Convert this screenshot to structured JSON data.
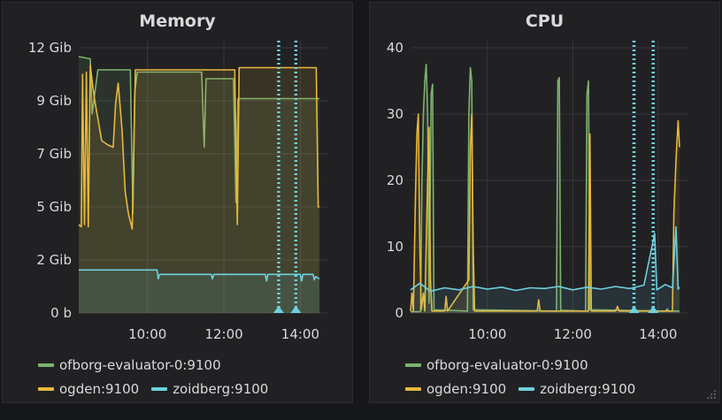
{
  "chart_data": [
    {
      "type": "area",
      "title": "Memory",
      "y_ticks": [
        "0 b",
        "2 Gib",
        "5 Gib",
        "7 Gib",
        "9 Gib",
        "12 Gib"
      ],
      "x_ticks": [
        "10:00",
        "12:00",
        "14:00"
      ],
      "xlim": [
        "08:12",
        "14:30"
      ],
      "ylim": [
        0,
        12
      ],
      "y_unit": "Gib",
      "grid": true,
      "legend_position": "bottom",
      "annotations_at": [
        "13:25",
        "13:52"
      ],
      "series": [
        {
          "name": "ofborg-evaluator-0:9100",
          "color": "#7eb26d",
          "points": [
            [
              "08:12",
              11.6
            ],
            [
              "08:30",
              11.5
            ],
            [
              "08:33",
              9.0
            ],
            [
              "08:42",
              11.0
            ],
            [
              "09:33",
              11.0
            ],
            [
              "09:37",
              4.5
            ],
            [
              "09:40",
              10.0
            ],
            [
              "09:44",
              10.9
            ],
            [
              "11:25",
              10.9
            ],
            [
              "11:29",
              7.5
            ],
            [
              "11:32",
              10.6
            ],
            [
              "12:15",
              10.6
            ],
            [
              "12:19",
              5.0
            ],
            [
              "12:22",
              9.7
            ],
            [
              "14:30",
              9.7
            ]
          ]
        },
        {
          "name": "ogden:9100",
          "color": "#eab839",
          "points": [
            [
              "08:12",
              4.0
            ],
            [
              "08:16",
              3.9
            ],
            [
              "08:18",
              10.8
            ],
            [
              "08:21",
              4.0
            ],
            [
              "08:24",
              10.9
            ],
            [
              "08:27",
              3.9
            ],
            [
              "08:30",
              11.2
            ],
            [
              "08:36",
              9.8
            ],
            [
              "08:48",
              7.8
            ],
            [
              "08:58",
              7.6
            ],
            [
              "09:06",
              7.5
            ],
            [
              "09:10",
              9.5
            ],
            [
              "09:14",
              10.4
            ],
            [
              "09:20",
              8.3
            ],
            [
              "09:25",
              5.5
            ],
            [
              "09:30",
              4.5
            ],
            [
              "09:36",
              3.8
            ],
            [
              "09:41",
              11.0
            ],
            [
              "12:17",
              11.0
            ],
            [
              "12:21",
              4.0
            ],
            [
              "12:24",
              11.1
            ],
            [
              "14:25",
              11.1
            ],
            [
              "14:28",
              4.8
            ],
            [
              "14:30",
              4.8
            ]
          ]
        },
        {
          "name": "zoidberg:9100",
          "color": "#6ed0e0",
          "points": [
            [
              "08:12",
              1.95
            ],
            [
              "10:15",
              1.95
            ],
            [
              "10:17",
              1.55
            ],
            [
              "10:19",
              1.75
            ],
            [
              "11:40",
              1.75
            ],
            [
              "11:42",
              1.55
            ],
            [
              "11:44",
              1.75
            ],
            [
              "13:05",
              1.75
            ],
            [
              "13:07",
              1.45
            ],
            [
              "13:09",
              1.75
            ],
            [
              "14:00",
              1.75
            ],
            [
              "14:02",
              1.45
            ],
            [
              "14:04",
              1.75
            ],
            [
              "14:20",
              1.75
            ],
            [
              "14:22",
              1.5
            ],
            [
              "14:24",
              1.65
            ],
            [
              "14:30",
              1.55
            ]
          ]
        }
      ]
    },
    {
      "type": "line",
      "title": "CPU",
      "y_ticks": [
        "0",
        "10",
        "20",
        "30",
        "40"
      ],
      "x_ticks": [
        "10:00",
        "12:00",
        "14:00"
      ],
      "xlim": [
        "08:12",
        "14:30"
      ],
      "ylim": [
        0,
        40
      ],
      "grid": true,
      "legend_position": "bottom",
      "annotations_at": [
        "13:25",
        "13:52"
      ],
      "series": [
        {
          "name": "ofborg-evaluator-0:9100",
          "color": "#7eb26d",
          "points": [
            [
              "08:12",
              0.2
            ],
            [
              "08:26",
              0.2
            ],
            [
              "08:28",
              20.0
            ],
            [
              "08:30",
              30.0
            ],
            [
              "08:32",
              35.0
            ],
            [
              "08:34",
              37.5
            ],
            [
              "08:36",
              30.0
            ],
            [
              "08:38",
              1.5
            ],
            [
              "08:41",
              33.0
            ],
            [
              "08:43",
              34.5
            ],
            [
              "08:45",
              0.5
            ],
            [
              "09:32",
              0.3
            ],
            [
              "09:34",
              30.0
            ],
            [
              "09:36",
              37.0
            ],
            [
              "09:38",
              35.0
            ],
            [
              "09:40",
              0.5
            ],
            [
              "11:37",
              0.3
            ],
            [
              "11:39",
              35.0
            ],
            [
              "11:41",
              35.5
            ],
            [
              "11:43",
              0.4
            ],
            [
              "12:18",
              0.3
            ],
            [
              "12:20",
              33.0
            ],
            [
              "12:22",
              35.0
            ],
            [
              "12:24",
              0.5
            ],
            [
              "14:10",
              0.3
            ],
            [
              "14:13",
              0.6
            ],
            [
              "14:15",
              0.3
            ],
            [
              "14:30",
              0.3
            ]
          ]
        },
        {
          "name": "ogden:9100",
          "color": "#eab839",
          "points": [
            [
              "08:12",
              0.3
            ],
            [
              "08:14",
              3.0
            ],
            [
              "08:16",
              0.3
            ],
            [
              "08:19",
              18.0
            ],
            [
              "08:21",
              27.0
            ],
            [
              "08:23",
              30.0
            ],
            [
              "08:25",
              10.0
            ],
            [
              "08:27",
              0.5
            ],
            [
              "08:30",
              3.0
            ],
            [
              "08:32",
              0.3
            ],
            [
              "08:36",
              20.0
            ],
            [
              "08:38",
              28.0
            ],
            [
              "08:40",
              5.0
            ],
            [
              "08:42",
              0.3
            ],
            [
              "09:00",
              0.3
            ],
            [
              "09:02",
              2.5
            ],
            [
              "09:04",
              0.3
            ],
            [
              "09:34",
              5.0
            ],
            [
              "09:36",
              25.0
            ],
            [
              "09:38",
              30.0
            ],
            [
              "09:40",
              10.0
            ],
            [
              "09:42",
              0.3
            ],
            [
              "11:10",
              0.3
            ],
            [
              "11:12",
              2.0
            ],
            [
              "11:14",
              0.3
            ],
            [
              "12:22",
              0.3
            ],
            [
              "12:24",
              27.0
            ],
            [
              "12:26",
              0.3
            ],
            [
              "13:00",
              0.3
            ],
            [
              "13:03",
              1.0
            ],
            [
              "13:05",
              0.3
            ],
            [
              "14:20",
              0.3
            ],
            [
              "14:22",
              15.0
            ],
            [
              "14:25",
              23.0
            ],
            [
              "14:28",
              29.0
            ],
            [
              "14:30",
              25.0
            ]
          ]
        },
        {
          "name": "zoidberg:9100",
          "color": "#6ed0e0",
          "points": [
            [
              "08:12",
              3.5
            ],
            [
              "08:25",
              4.5
            ],
            [
              "08:40",
              3.3
            ],
            [
              "09:00",
              3.8
            ],
            [
              "09:20",
              3.5
            ],
            [
              "09:40",
              4.0
            ],
            [
              "10:00",
              3.6
            ],
            [
              "10:20",
              3.9
            ],
            [
              "10:40",
              3.4
            ],
            [
              "11:00",
              3.8
            ],
            [
              "11:20",
              3.7
            ],
            [
              "11:40",
              4.0
            ],
            [
              "12:00",
              3.5
            ],
            [
              "12:20",
              3.9
            ],
            [
              "12:40",
              3.6
            ],
            [
              "13:00",
              4.0
            ],
            [
              "13:20",
              3.7
            ],
            [
              "13:40",
              4.2
            ],
            [
              "13:55",
              12.0
            ],
            [
              "13:58",
              3.5
            ],
            [
              "14:10",
              4.3
            ],
            [
              "14:20",
              3.8
            ],
            [
              "14:25",
              13.0
            ],
            [
              "14:28",
              3.6
            ],
            [
              "14:30",
              3.9
            ]
          ]
        }
      ]
    }
  ]
}
